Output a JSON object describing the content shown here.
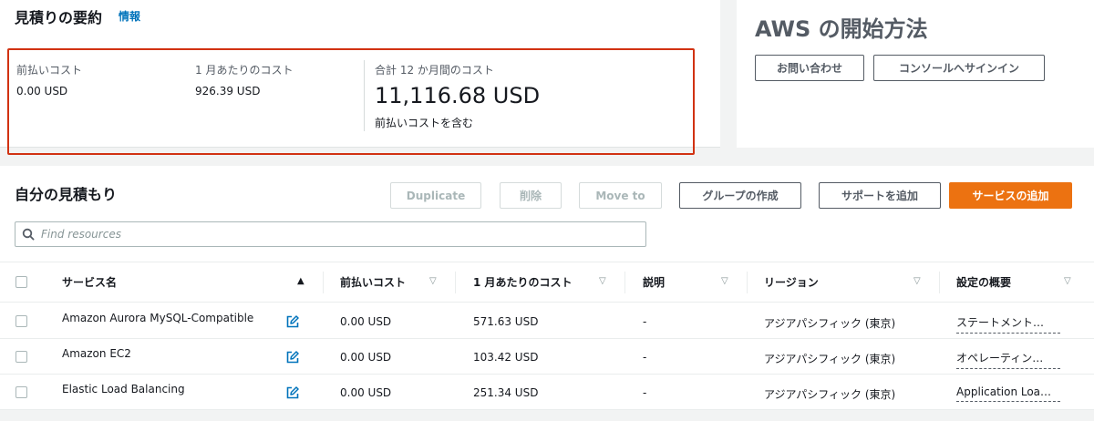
{
  "summary": {
    "title": "見積りの要約",
    "info_link": "情報",
    "upfront_label": "前払いコスト",
    "upfront_value": "0.00 USD",
    "monthly_label": "1 月あたりのコスト",
    "monthly_value": "926.39 USD",
    "total_label": "合計 12 か月間のコスト",
    "total_value": "11,116.68 USD",
    "total_note": "前払いコストを含む"
  },
  "getting_started": {
    "title": "AWS の開始方法",
    "contact_button": "お問い合わせ",
    "console_button": "コンソールへサインイン"
  },
  "estimate": {
    "title": "自分の見積もり",
    "duplicate_button": "Duplicate",
    "delete_button": "削除",
    "move_button": "Move to",
    "create_group_button": "グループの作成",
    "add_support_button": "サポートを追加",
    "add_service_button": "サービスの追加",
    "search_placeholder": "Find resources"
  },
  "table": {
    "columns": [
      "サービス名",
      "前払いコスト",
      "1 月あたりのコスト",
      "説明",
      "リージョン",
      "設定の概要"
    ],
    "rows": [
      {
        "service": "Amazon Aurora MySQL-Compatible",
        "upfront": "0.00 USD",
        "monthly": "571.63 USD",
        "description": "-",
        "region": "アジアパシフィック (東京)",
        "config": "ステートメント…"
      },
      {
        "service": "Amazon EC2",
        "upfront": "0.00 USD",
        "monthly": "103.42 USD",
        "description": "-",
        "region": "アジアパシフィック (東京)",
        "config": "オペレーティン…"
      },
      {
        "service": "Elastic Load Balancing",
        "upfront": "0.00 USD",
        "monthly": "251.34 USD",
        "description": "-",
        "region": "アジアパシフィック (東京)",
        "config": "Application Loa…"
      }
    ]
  },
  "colors": {
    "highlight": "#d13212",
    "primary": "#ec7211",
    "link": "#0073bb"
  }
}
